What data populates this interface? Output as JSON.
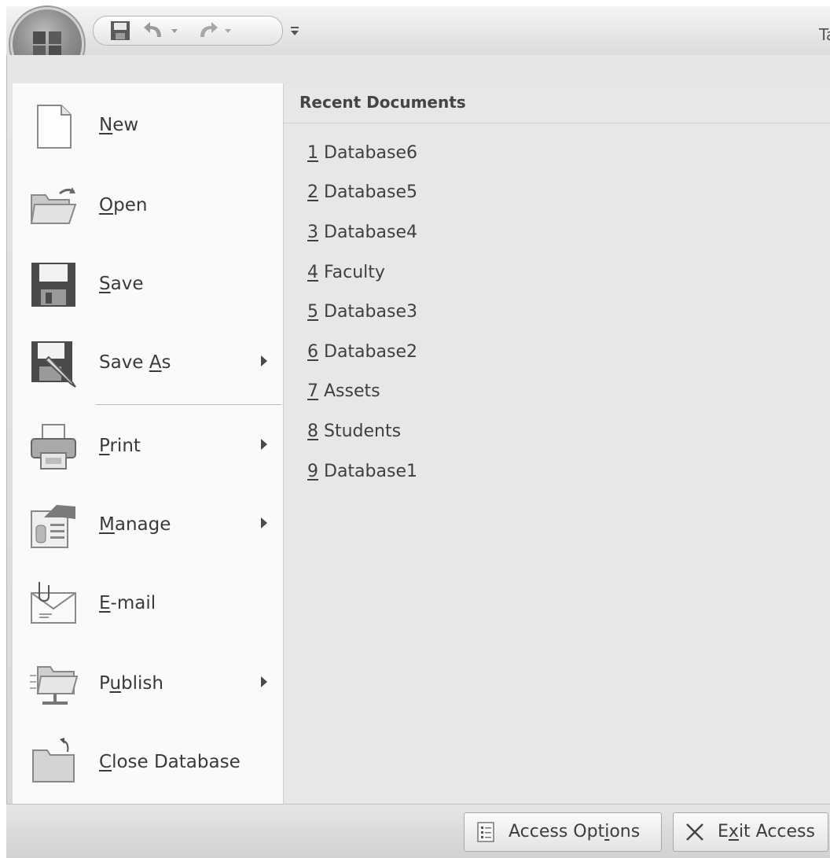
{
  "quick_access": {
    "save": "save-icon",
    "undo": "undo-icon",
    "redo": "redo-icon",
    "customize": "customize-qat-icon"
  },
  "window_title_fragment": "Ta",
  "menu": {
    "items": [
      {
        "pre": "",
        "key": "N",
        "post": "ew",
        "icon": "new-document-icon",
        "submenu": false
      },
      {
        "pre": "",
        "key": "O",
        "post": "pen",
        "icon": "open-folder-icon",
        "submenu": false
      },
      {
        "pre": "",
        "key": "S",
        "post": "ave",
        "icon": "save-disk-icon",
        "submenu": false
      },
      {
        "pre": "Save ",
        "key": "A",
        "post": "s",
        "icon": "save-as-icon",
        "submenu": true
      },
      {
        "pre": "",
        "key": "P",
        "post": "rint",
        "icon": "printer-icon",
        "submenu": true
      },
      {
        "pre": "",
        "key": "M",
        "post": "anage",
        "icon": "manage-icon",
        "submenu": true
      },
      {
        "pre": "",
        "key": "E",
        "post": "-mail",
        "icon": "email-icon",
        "submenu": false
      },
      {
        "pre": "P",
        "key": "u",
        "post": "blish",
        "icon": "publish-icon",
        "submenu": true
      },
      {
        "pre": "",
        "key": "C",
        "post": "lose Database",
        "icon": "close-database-icon",
        "submenu": false
      }
    ]
  },
  "recent": {
    "header": "Recent Documents",
    "items": [
      {
        "num": "1",
        "name": "Database6"
      },
      {
        "num": "2",
        "name": "Database5"
      },
      {
        "num": "3",
        "name": "Database4"
      },
      {
        "num": "4",
        "name": "Faculty"
      },
      {
        "num": "5",
        "name": "Database3"
      },
      {
        "num": "6",
        "name": "Database2"
      },
      {
        "num": "7",
        "name": "Assets"
      },
      {
        "num": "8",
        "name": "Students"
      },
      {
        "num": "9",
        "name": "Database1"
      }
    ]
  },
  "bottom": {
    "options": {
      "pre": "Access Opt",
      "key": "i",
      "post": "ons",
      "icon": "options-icon"
    },
    "exit": {
      "pre": "E",
      "key": "x",
      "post": "it Access",
      "icon": "close-x-icon"
    }
  },
  "colors": {
    "left_pane": "#fafafa",
    "right_pane": "#e7e7e7",
    "frame": "#dcdcdc",
    "text": "#3d3d3d"
  }
}
